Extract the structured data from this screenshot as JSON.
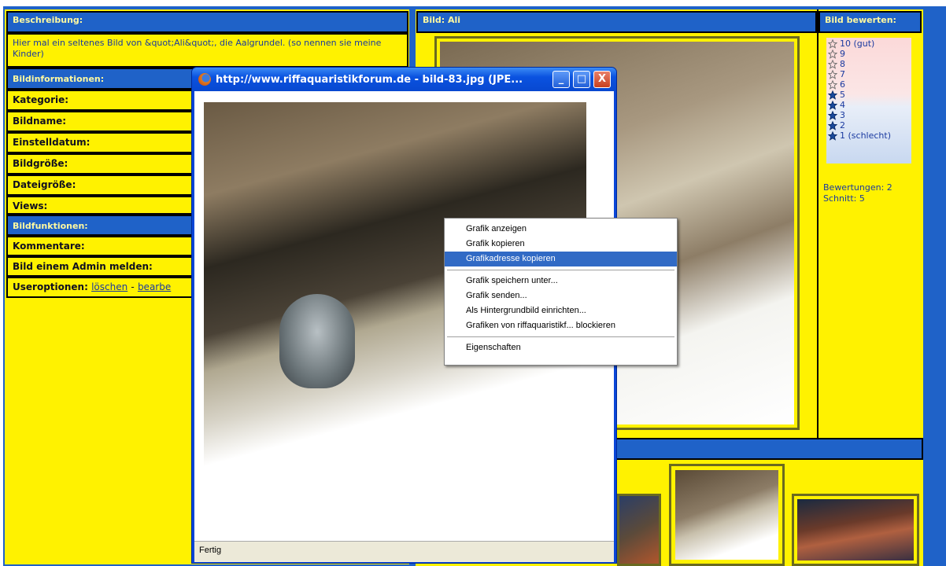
{
  "forum": {
    "beschreibung_header": "Beschreibung:",
    "beschreibung_text": "Hier mal ein seltenes Bild von &quot;Ali&quot;, die Aalgrundel. (so nennen sie meine Kinder)",
    "bildinfo_header": "Bildinformationen:",
    "info_rows": [
      "Kategorie:",
      "Bildname:",
      "Einstelldatum:",
      "Bildgröße:",
      "Dateigröße:",
      "Views:"
    ],
    "funktionen_header": "Bildfunktionen:",
    "funktion_rows": [
      "Kommentare:",
      "Bild einem Admin melden:"
    ],
    "useroptionen_label": "Useroptionen:",
    "loeschen_link": "löschen",
    "dash": "-",
    "bearbeiten_link": "bearbe",
    "bild_header": "Bild: Ali",
    "bewerten_header": "Bild bewerten:",
    "ratings": [
      {
        "label": "10 (gut)",
        "filled": false
      },
      {
        "label": "9",
        "filled": false
      },
      {
        "label": "8",
        "filled": false
      },
      {
        "label": "7",
        "filled": false
      },
      {
        "label": "6",
        "filled": false
      },
      {
        "label": "5",
        "filled": true
      },
      {
        "label": "4",
        "filled": true
      },
      {
        "label": "3",
        "filled": true
      },
      {
        "label": "2",
        "filled": true
      },
      {
        "label": "1 (schlecht)",
        "filled": true
      }
    ],
    "bewertungen": "Bewertungen: 2",
    "schnitt": "Schnitt: 5"
  },
  "popup": {
    "title": "http://www.riffaquaristikforum.de - bild-83.jpg (JPE...",
    "status": "Fertig",
    "minimize_icon": "_",
    "maximize_icon": "□",
    "close_icon": "X"
  },
  "context_menu": {
    "group1": [
      "Grafik anzeigen",
      "Grafik kopieren",
      "Grafikadresse kopieren"
    ],
    "group2": [
      "Grafik speichern unter...",
      "Grafik senden...",
      "Als Hintergrundbild einrichten...",
      "Grafiken von riffaquaristikf... blockieren"
    ],
    "group3": [
      "Eigenschaften"
    ],
    "selected": "Grafikadresse kopieren"
  },
  "colors": {
    "forum_yellow": "#fff200",
    "forum_blue": "#1f62c8",
    "xp_title_blue": "#0a52e0",
    "menu_highlight": "#316ac5"
  }
}
